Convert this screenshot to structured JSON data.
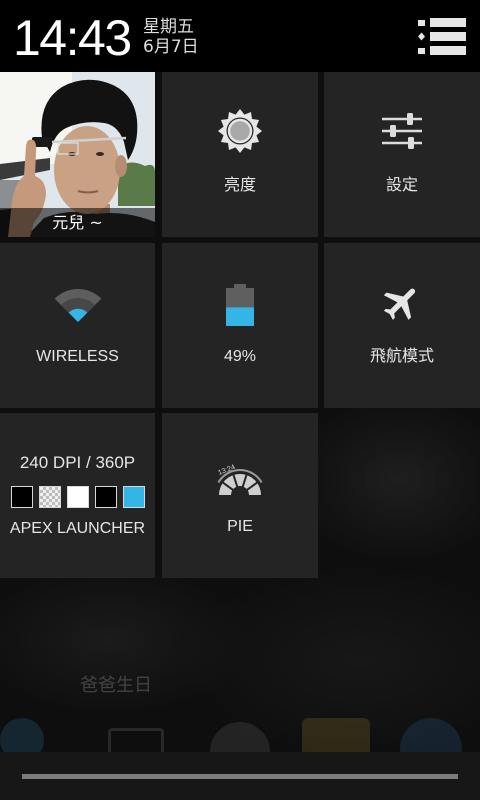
{
  "header": {
    "time": "14:43",
    "weekday": "星期五",
    "date": "6月7日",
    "toggle_icon": "list-icon"
  },
  "colors": {
    "accent": "#33b5e5",
    "tile": "#252525",
    "header": "#000000",
    "text": "#e6e6e6"
  },
  "tiles": {
    "user": {
      "label": "元兒 ~",
      "icon": "user-photo"
    },
    "brightness": {
      "label": "亮度",
      "icon": "brightness-icon"
    },
    "settings": {
      "label": "設定",
      "icon": "settings-sliders-icon"
    },
    "wireless": {
      "label": "WIRELESS",
      "icon": "wifi-icon",
      "signal_level": 1,
      "signal_max": 4
    },
    "battery": {
      "label": "49%",
      "icon": "battery-icon",
      "level_percent": 49
    },
    "airplane": {
      "label": "飛航模式",
      "icon": "airplane-icon"
    },
    "apex": {
      "resolution": "240 DPI / 360P",
      "label": "APEX LAUNCHER",
      "swatches": [
        "#000000",
        "checkerboard",
        "#ffffff",
        "#000000",
        "#33b5e5"
      ]
    },
    "pie": {
      "label": "PIE",
      "icon": "pie-icon",
      "icon_clock": "13:24"
    }
  },
  "home_background": {
    "calendar_event": "爸爸生日"
  }
}
